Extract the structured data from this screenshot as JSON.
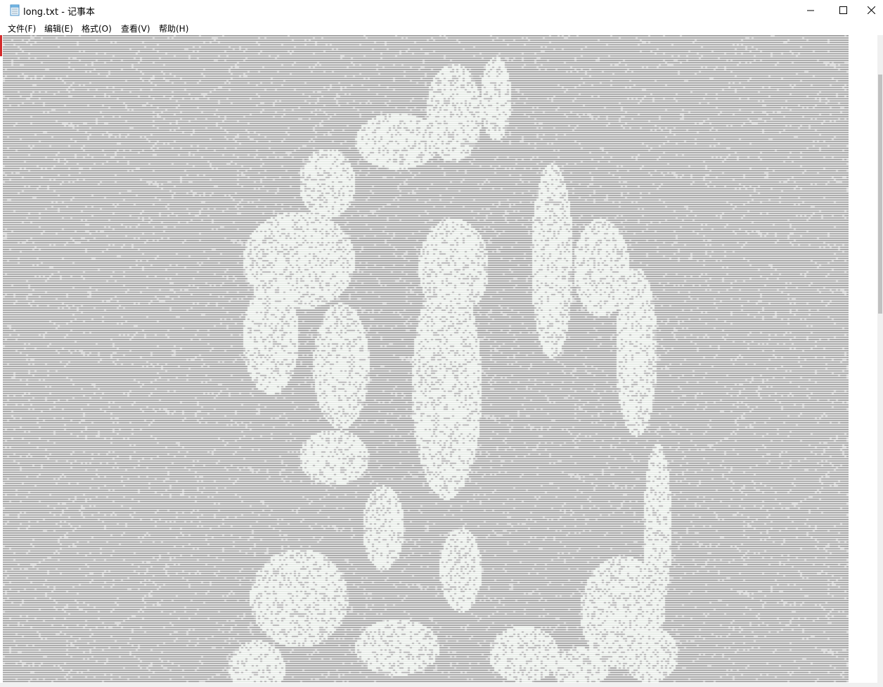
{
  "window": {
    "title": "long.txt - 记事本",
    "icon": "notepad-icon",
    "controls": [
      "minimize-icon",
      "maximize-icon",
      "close-icon"
    ]
  },
  "menu": {
    "items": [
      {
        "label": "文件(F)"
      },
      {
        "label": "编辑(E)"
      },
      {
        "label": "格式(O)"
      },
      {
        "label": "查看(V)"
      },
      {
        "label": "帮助(H)"
      }
    ]
  },
  "document": {
    "content_description_hidden": "",
    "colors": {
      "background": "#ffffff",
      "text_dark": "#8a8a8a",
      "text_light": "#dfe6df",
      "accent": "#d42b2b"
    }
  }
}
